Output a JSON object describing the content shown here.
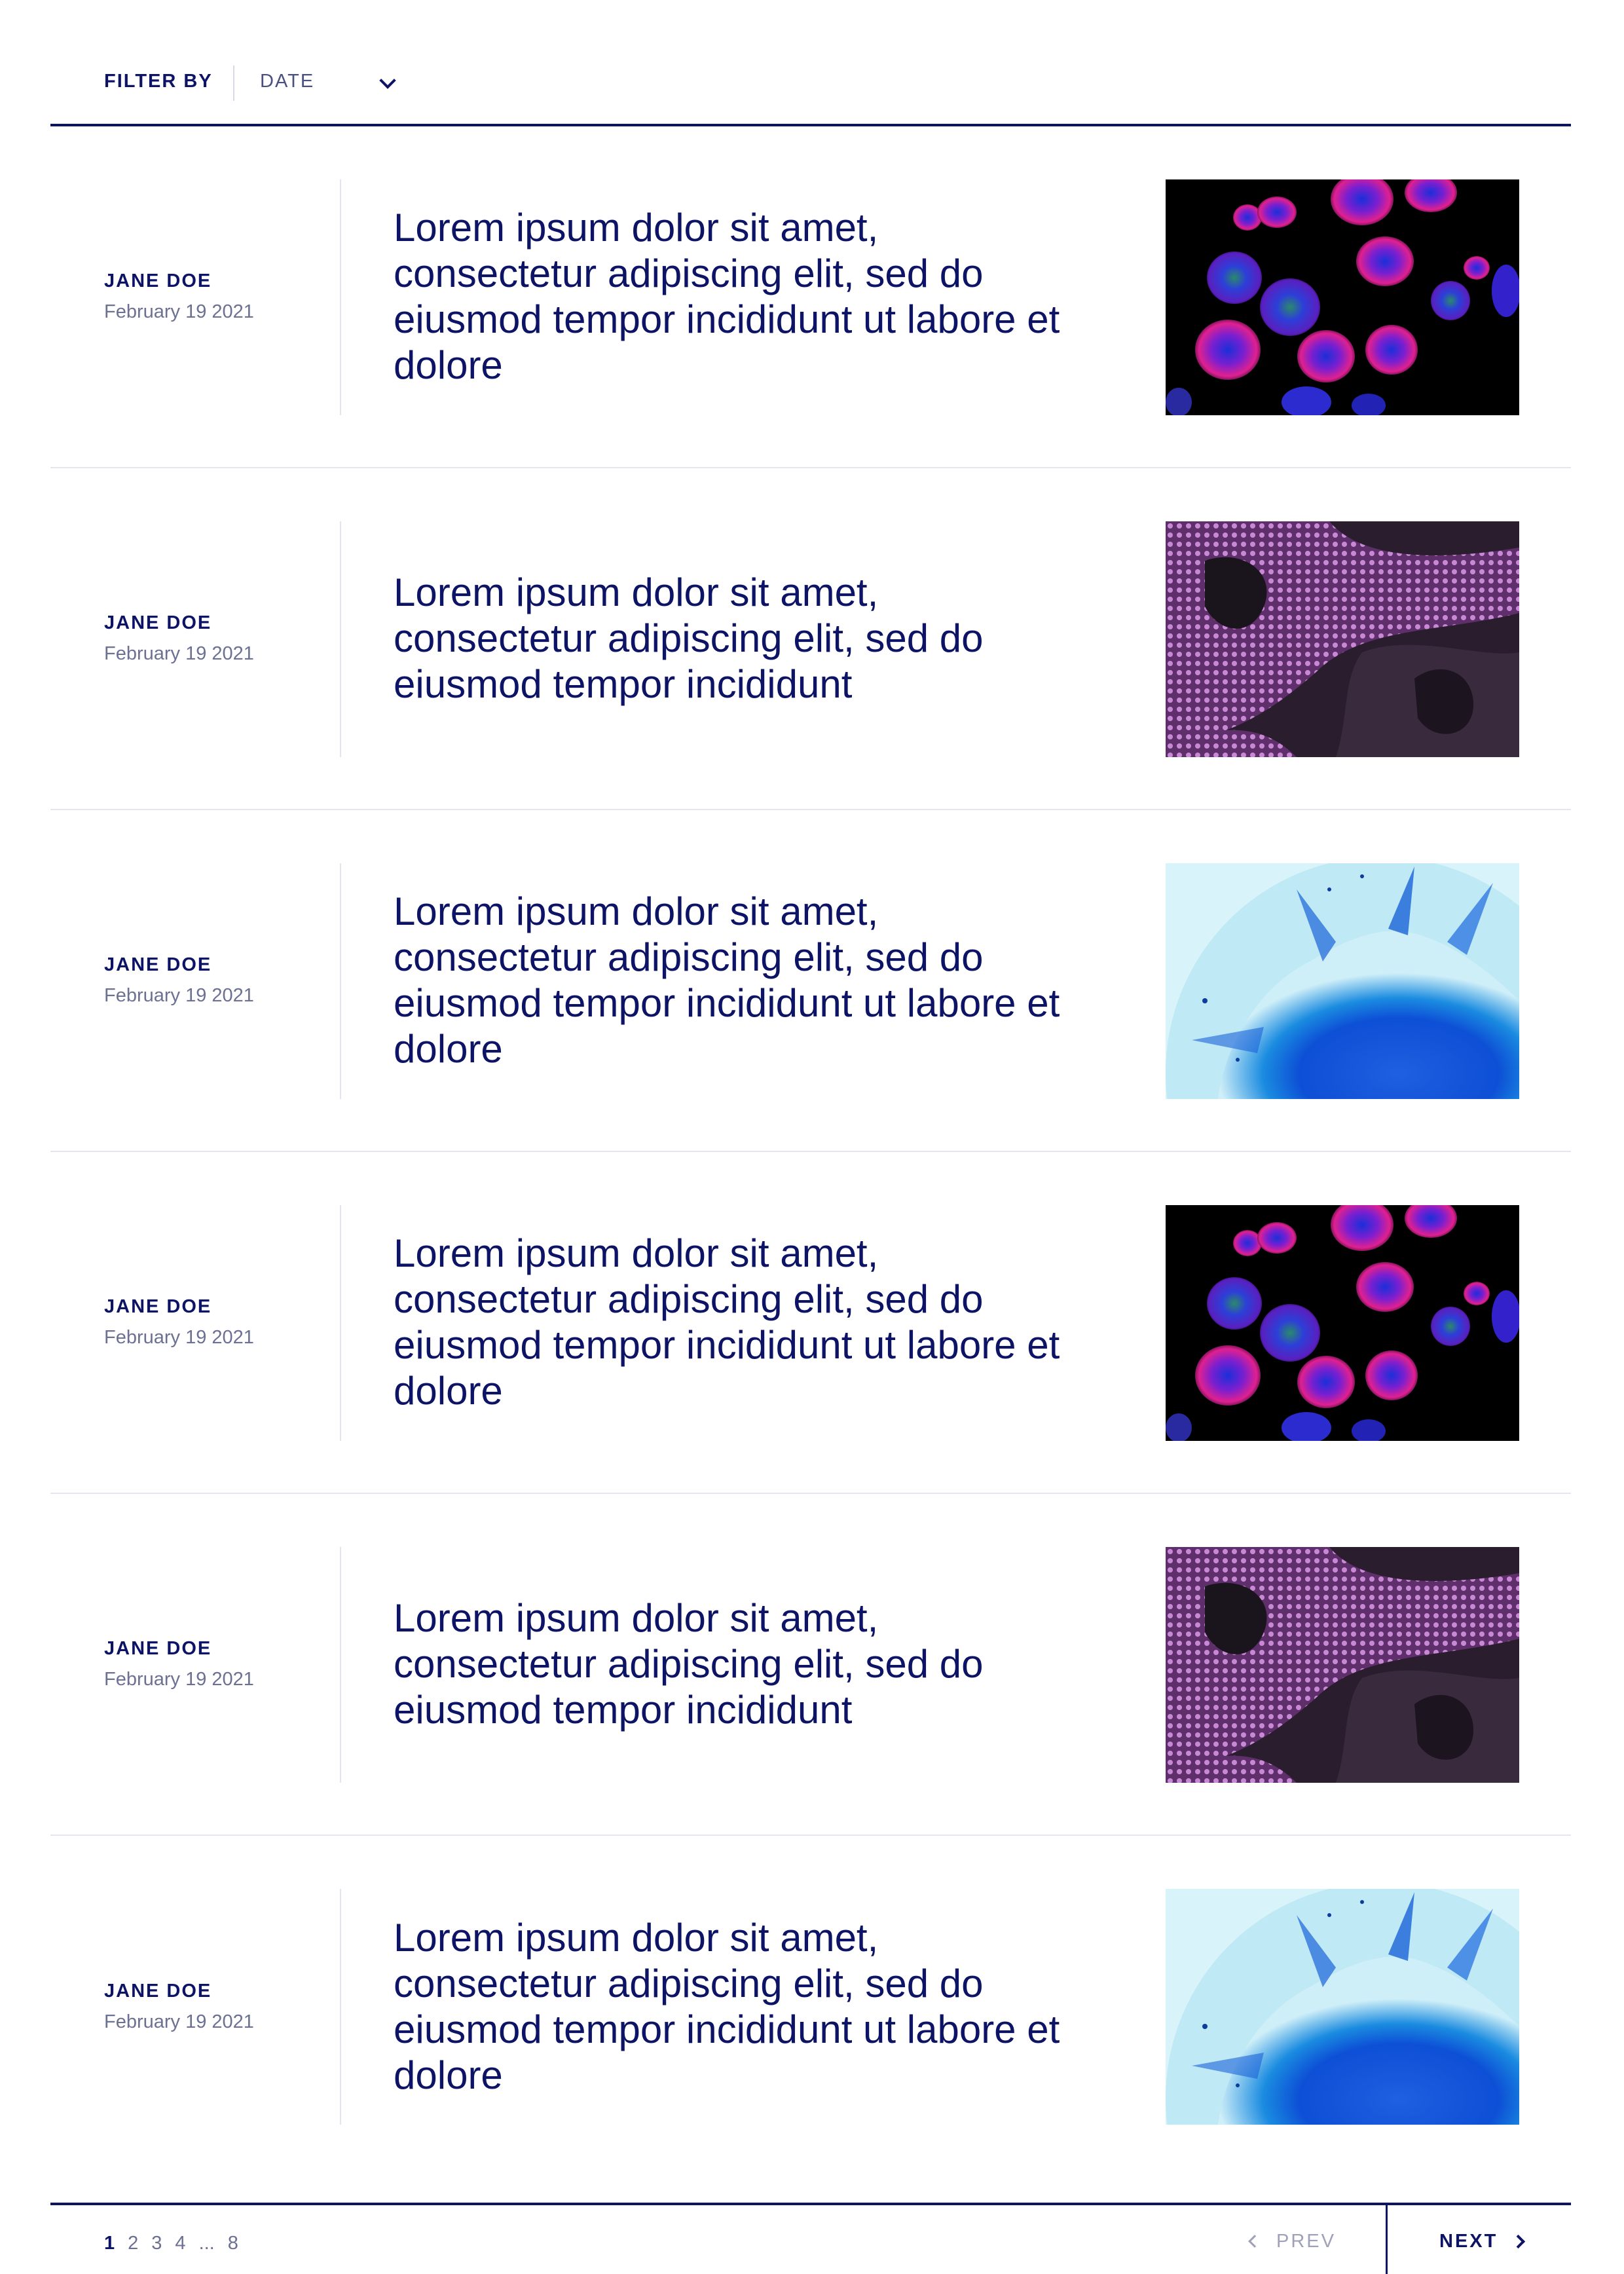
{
  "filter": {
    "label": "FILTER BY",
    "selected": "DATE",
    "icon": "chevron-down-icon"
  },
  "articles": [
    {
      "author": "JANE DOE",
      "date": "February 19 2021",
      "title": "Lorem ipsum dolor sit amet, consectetur adipiscing elit, sed do eiusmod tempor incididunt ut labore et dolore",
      "image": "fluorescent-cells-image"
    },
    {
      "author": "JANE DOE",
      "date": "February 19 2021",
      "title": "Lorem ipsum dolor sit amet, consectetur adipiscing elit, sed do eiusmod tempor incididunt",
      "image": "purple-tissue-image"
    },
    {
      "author": "JANE DOE",
      "date": "February 19 2021",
      "title": "Lorem ipsum dolor sit amet, consectetur adipiscing elit, sed do eiusmod tempor incididunt ut labore et dolore",
      "image": "blue-petri-dish-image"
    },
    {
      "author": "JANE DOE",
      "date": "February 19 2021",
      "title": "Lorem ipsum dolor sit amet, consectetur adipiscing elit, sed do eiusmod tempor incididunt ut labore et dolore",
      "image": "fluorescent-cells-image"
    },
    {
      "author": "JANE DOE",
      "date": "February 19 2021",
      "title": "Lorem ipsum dolor sit amet, consectetur adipiscing elit, sed do eiusmod tempor incididunt",
      "image": "purple-tissue-image"
    },
    {
      "author": "JANE DOE",
      "date": "February 19 2021",
      "title": "Lorem ipsum dolor sit amet, consectetur adipiscing elit, sed do eiusmod tempor incididunt ut labore et dolore",
      "image": "blue-petri-dish-image"
    }
  ],
  "pagination": {
    "pages": [
      "1",
      "2",
      "3",
      "4"
    ],
    "current": "1",
    "ellipsis": "...",
    "last": "8",
    "prev_label": "PREV",
    "next_label": "NEXT"
  },
  "colors": {
    "navy": "#0d1466",
    "muted": "#6c7193",
    "disabled": "#9ea1b8"
  }
}
